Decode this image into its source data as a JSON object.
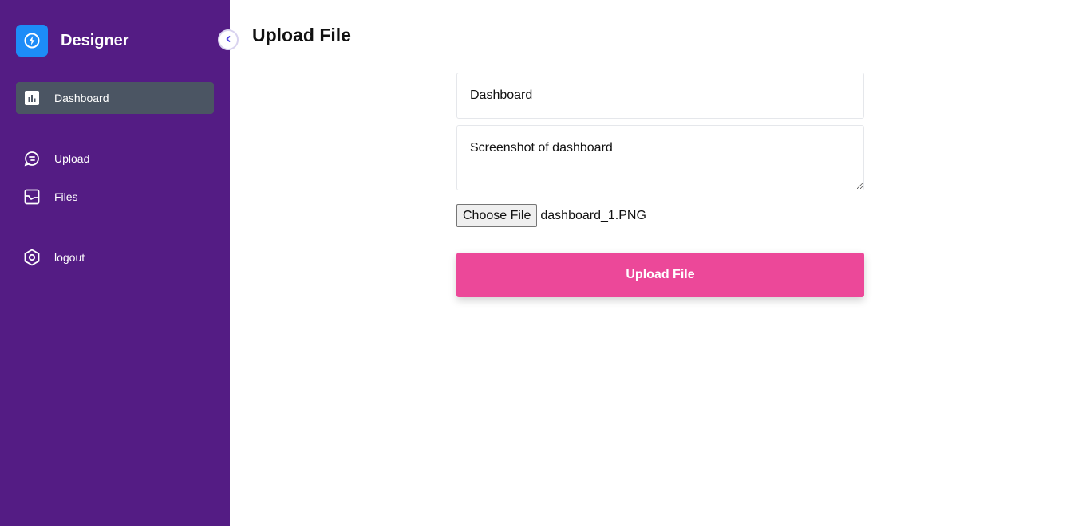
{
  "brand": {
    "name": "Designer",
    "logo_icon": "bolt-icon",
    "color": "#1d8cf8"
  },
  "sidebar": {
    "background": "#541c84",
    "collapse_icon": "chevron-left-icon",
    "items": [
      {
        "label": "Dashboard",
        "icon": "bar-chart-icon",
        "active": true
      },
      {
        "label": "Upload",
        "icon": "upload-icon",
        "active": false
      },
      {
        "label": "Files",
        "icon": "files-icon",
        "active": false
      },
      {
        "label": "logout",
        "icon": "hexagon-icon",
        "active": false
      }
    ]
  },
  "page": {
    "title": "Upload File"
  },
  "form": {
    "title_value": "Dashboard",
    "description_value": "Screenshot of dashboard",
    "choose_file_label": "Choose File",
    "file_name": "dashboard_1.PNG",
    "submit_label": "Upload File",
    "submit_color": "#ec4899"
  }
}
